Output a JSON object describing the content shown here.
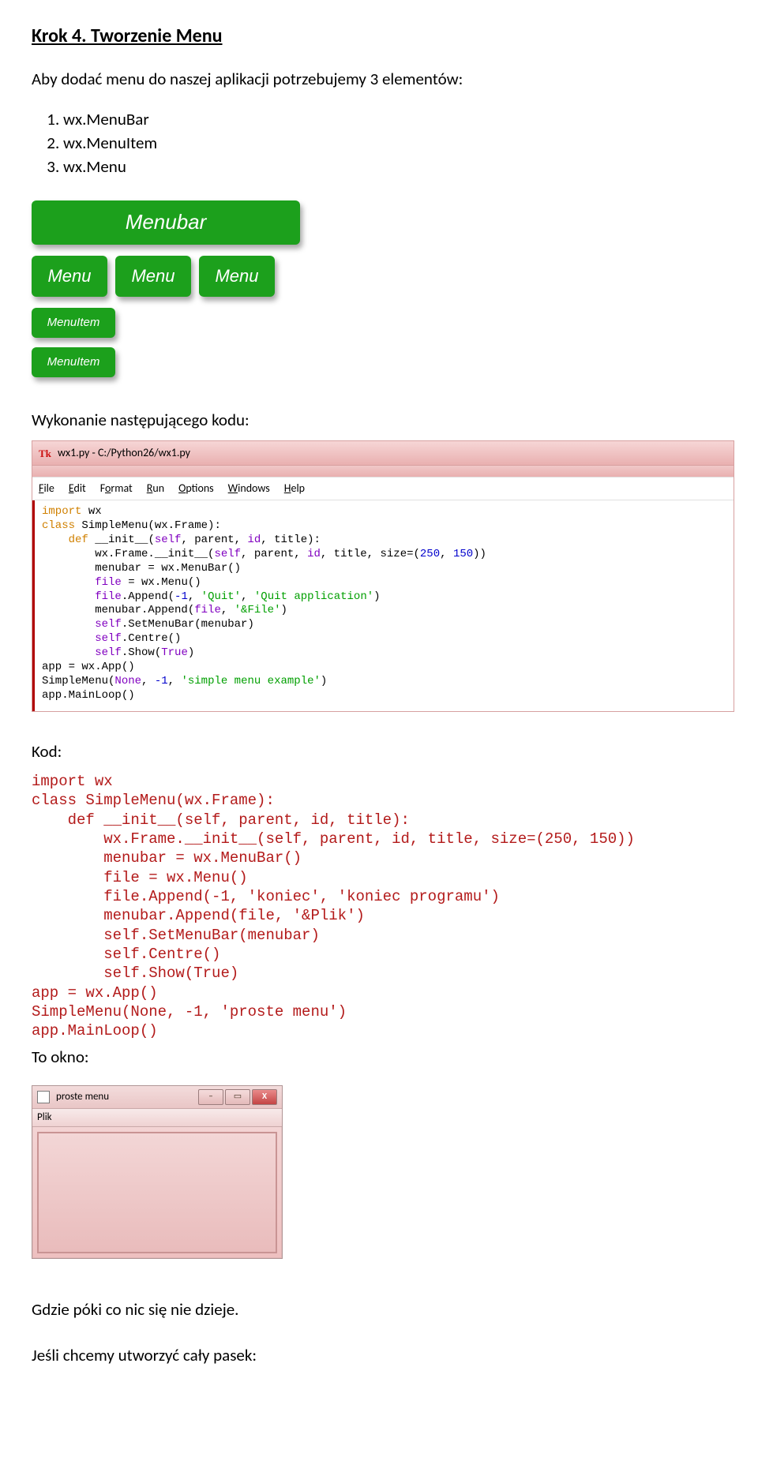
{
  "heading": "Krok 4. Tworzenie Menu",
  "intro": "Aby dodać menu do naszej aplikacji potrzebujemy 3 elementów:",
  "list": [
    "wx.MenuBar",
    "wx.MenuItem",
    "wx.Menu"
  ],
  "diagram": {
    "bar": "Menubar",
    "menu": "Menu",
    "item": "MenuItem"
  },
  "lead2": "Wykonanie następującego kodu:",
  "idle": {
    "title": "wx1.py - C:/Python26/wx1.py",
    "icon": "Tk",
    "menu": {
      "file": "File",
      "edit": "Edit",
      "format": "Format",
      "run": "Run",
      "options": "Options",
      "windows": "Windows",
      "help": "Help"
    }
  },
  "kod_label": "Kod:",
  "to_okno": "To okno:",
  "result": {
    "title": "proste menu",
    "menu_item": "Plik",
    "minimize": "–",
    "maximize": "▭",
    "close": "X"
  },
  "bottom1": "Gdzie póki co nic się nie dzieje.",
  "bottom2": "Jeśli chcemy utworzyć cały pasek:"
}
